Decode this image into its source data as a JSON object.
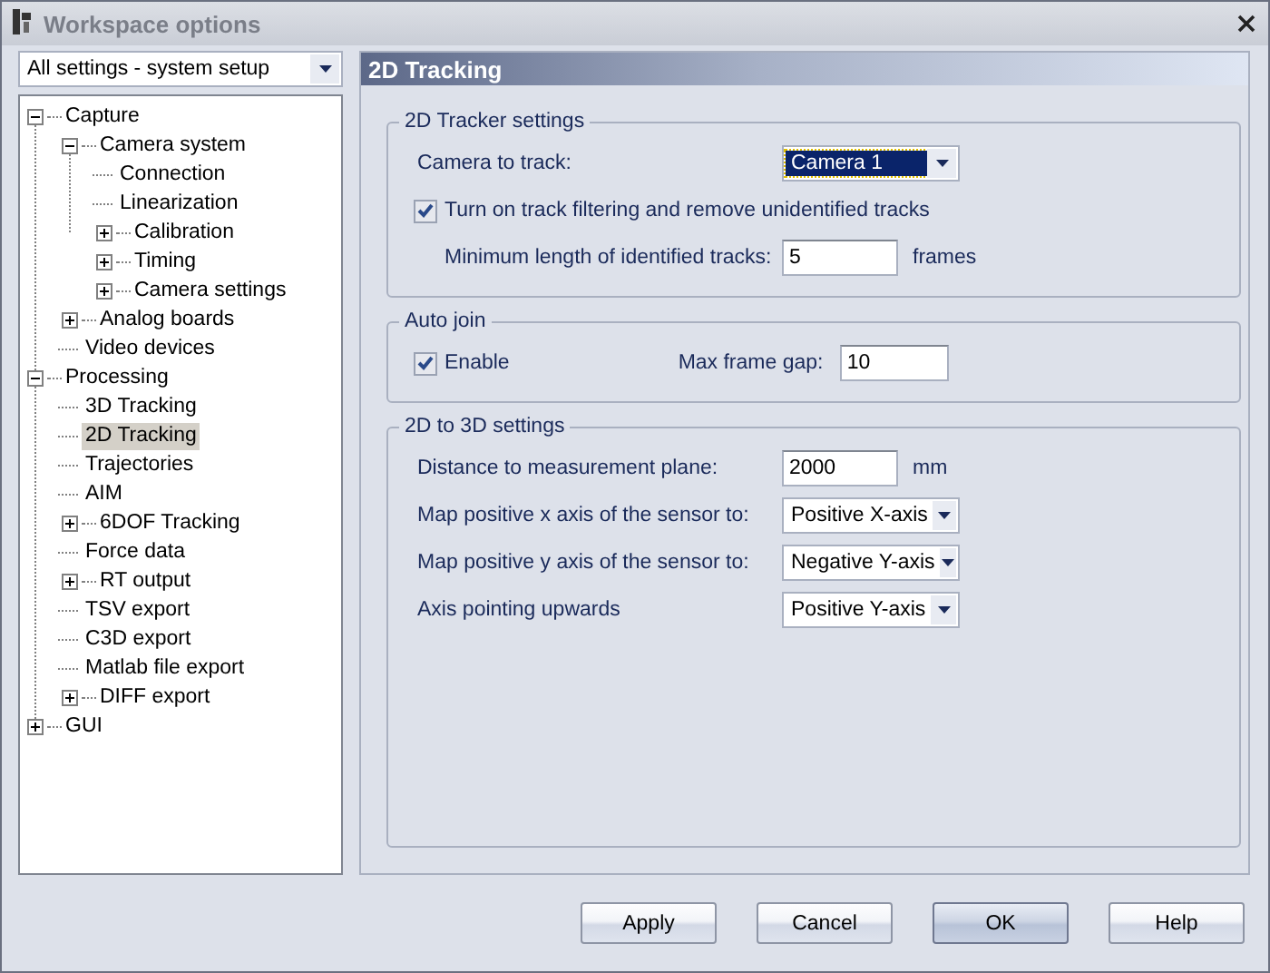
{
  "window": {
    "title": "Workspace options"
  },
  "settings_filter": {
    "value": "All settings - system setup"
  },
  "tree": [
    {
      "label": "Capture",
      "expanded": true,
      "selected": false,
      "children": [
        {
          "label": "Camera system",
          "expanded": true,
          "selected": false,
          "children": [
            {
              "label": "Connection",
              "selected": false
            },
            {
              "label": "Linearization",
              "selected": false
            },
            {
              "label": "Calibration",
              "expanded": false,
              "selected": false
            },
            {
              "label": "Timing",
              "expanded": false,
              "selected": false
            },
            {
              "label": "Camera settings",
              "expanded": false,
              "selected": false
            }
          ]
        },
        {
          "label": "Analog boards",
          "expanded": false,
          "selected": false
        },
        {
          "label": "Video devices",
          "selected": false
        }
      ]
    },
    {
      "label": "Processing",
      "expanded": true,
      "selected": false,
      "children": [
        {
          "label": "3D Tracking",
          "selected": false
        },
        {
          "label": "2D Tracking",
          "selected": true
        },
        {
          "label": "Trajectories",
          "selected": false
        },
        {
          "label": "AIM",
          "selected": false
        },
        {
          "label": "6DOF Tracking",
          "expanded": false,
          "selected": false
        },
        {
          "label": "Force data",
          "selected": false
        },
        {
          "label": "RT output",
          "expanded": false,
          "selected": false
        },
        {
          "label": "TSV export",
          "selected": false
        },
        {
          "label": "C3D export",
          "selected": false
        },
        {
          "label": "Matlab file export",
          "selected": false
        },
        {
          "label": "DIFF export",
          "expanded": false,
          "selected": false
        }
      ]
    },
    {
      "label": "GUI",
      "expanded": false,
      "selected": false
    }
  ],
  "panel": {
    "title": "2D Tracking",
    "groups": [
      {
        "title": "2D Tracker settings",
        "rows": [
          {
            "kind": "dropdown",
            "label": "Camera to track:",
            "value": "Camera 1",
            "focused": true
          },
          {
            "kind": "checkbox",
            "label": "Turn on track filtering and remove unidentified tracks",
            "checked": true
          },
          {
            "kind": "number",
            "label": "Minimum length of identified tracks:",
            "value": "5",
            "unit": "frames"
          }
        ]
      },
      {
        "title": "Auto join",
        "rows": [
          {
            "kind": "checkbox_field",
            "label": "Enable",
            "checked": true,
            "field_label": "Max frame gap:",
            "value": "10"
          }
        ]
      },
      {
        "title": "2D to 3D settings",
        "rows": [
          {
            "kind": "number",
            "label": "Distance to measurement plane:",
            "value": "2000",
            "unit": "mm"
          },
          {
            "kind": "dropdown",
            "label": "Map positive x axis of the sensor to:",
            "value": "Positive X-axis",
            "focused": false
          },
          {
            "kind": "dropdown",
            "label": "Map positive y axis of the sensor to:",
            "value": "Negative Y-axis",
            "focused": false
          },
          {
            "kind": "dropdown",
            "label": "Axis pointing upwards",
            "value": "Positive Y-axis",
            "focused": false
          }
        ]
      }
    ]
  },
  "buttons": [
    {
      "label": "Apply",
      "default": false
    },
    {
      "label": "Cancel",
      "default": false
    },
    {
      "label": "OK",
      "default": true
    },
    {
      "label": "Help",
      "default": false
    }
  ]
}
